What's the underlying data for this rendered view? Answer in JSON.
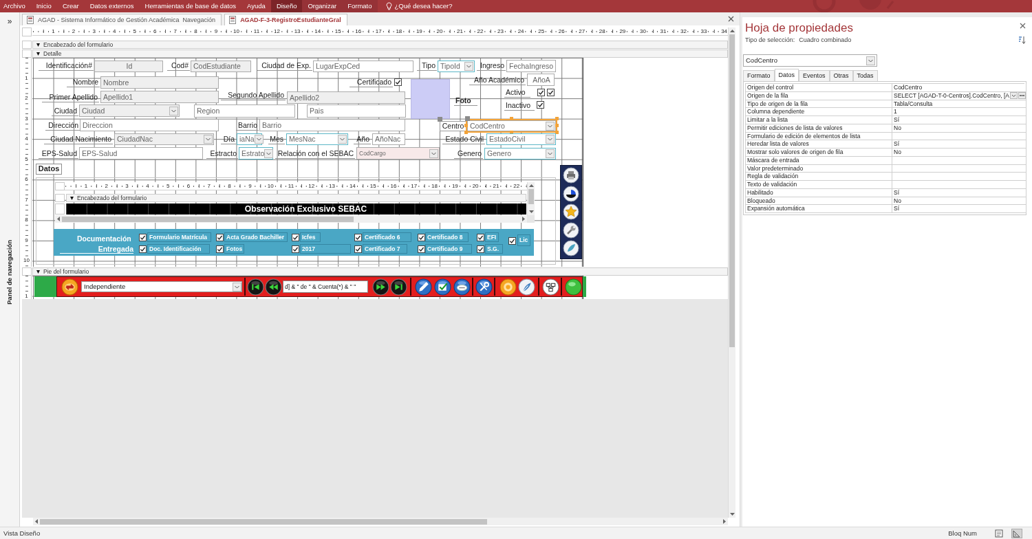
{
  "menu_bar": {
    "items": [
      {
        "label": "Archivo",
        "selected": false,
        "contextual": false
      },
      {
        "label": "Inicio",
        "selected": false,
        "contextual": false
      },
      {
        "label": "Crear",
        "selected": false,
        "contextual": false
      },
      {
        "label": "Datos externos",
        "selected": false,
        "contextual": false
      },
      {
        "label": "Herramientas de base de datos",
        "selected": false,
        "contextual": false
      },
      {
        "label": "Ayuda",
        "selected": false,
        "contextual": false
      },
      {
        "label": "Diseño",
        "selected": true,
        "contextual": true
      },
      {
        "label": "Organizar",
        "selected": false,
        "contextual": true
      },
      {
        "label": "Formato",
        "selected": false,
        "contextual": true
      }
    ],
    "tell_me": "¿Qué desea hacer?"
  },
  "navigation_pane": {
    "toggle": "»",
    "title": "Panel de navegación"
  },
  "document_tabs": [
    {
      "label": "AGAD - Sistema Informático de Gestión Académica  Navegación",
      "selected": false
    },
    {
      "label": "AGAD-F-3-RegistroEstudianteGral",
      "selected": true
    }
  ],
  "ruler": [
    "1",
    "2",
    "3",
    "4",
    "5",
    "6",
    "7",
    "8",
    "9",
    "10",
    "11",
    "12",
    "13",
    "14",
    "15",
    "16",
    "17",
    "18",
    "19",
    "20",
    "21",
    "22",
    "23",
    "24",
    "25",
    "26",
    "27",
    "28",
    "29",
    "30",
    "31",
    "32",
    "33",
    "34"
  ],
  "sections": {
    "header": "Encabezado del formulario",
    "detail": "Detalle",
    "footer": "Pie del formulario"
  },
  "detail_ruler": [
    "1",
    "2",
    "3",
    "4",
    "5",
    "6",
    "7",
    "8",
    "9",
    "10"
  ],
  "footer_ruler": [
    "1"
  ],
  "detail_controls": [
    {
      "kind": "label",
      "text": "Identificación#",
      "selected": false
    },
    {
      "kind": "textbox",
      "value": "Id",
      "color": "#efefef",
      "selected": false
    },
    {
      "kind": "label",
      "text": "Cod#",
      "selected": false
    },
    {
      "kind": "textbox",
      "value": "CodEstudiante",
      "color": "#efefef",
      "selected": false
    },
    {
      "kind": "label",
      "text": "Ciudad de Exp.",
      "selected": false
    },
    {
      "kind": "textbox",
      "value": "LugarExpCed",
      "color": "#ffffff",
      "selected": false
    },
    {
      "kind": "label",
      "text": "Tipo",
      "selected": false
    },
    {
      "kind": "combo",
      "value": "TipoId",
      "color": "#ffffff",
      "border": {
        "color": "#5bb6c6"
      },
      "selected": false
    },
    {
      "kind": "label",
      "text": "Ingreso",
      "selected": false
    },
    {
      "kind": "textbox",
      "value": "FechaIngreso",
      "color": "#ffffff",
      "selected": false
    },
    {
      "kind": "label",
      "text": "Nombre",
      "selected": false
    },
    {
      "kind": "textbox",
      "value": "Nombre",
      "color": "#efefef",
      "selected": false
    },
    {
      "kind": "label",
      "text": "Certificado",
      "selected": false
    },
    {
      "kind": "checkbox",
      "checked": true,
      "selected": false
    },
    {
      "kind": "image",
      "color": "#ccccf6",
      "selected": false
    },
    {
      "kind": "label",
      "text": "Año Académico",
      "selected": false
    },
    {
      "kind": "textbox",
      "value": "AñoA",
      "color": "#ffffff",
      "selected": false
    },
    {
      "kind": "label",
      "text": "Primer Apellido",
      "selected": false
    },
    {
      "kind": "textbox",
      "value": "Apellido1",
      "color": "#efefef",
      "selected": false
    },
    {
      "kind": "label",
      "text": "Segundo Apellido",
      "selected": false
    },
    {
      "kind": "textbox",
      "value": "Apellido2",
      "color": "#efefef",
      "selected": false
    },
    {
      "kind": "caption",
      "text": "Foto",
      "selected": false
    },
    {
      "kind": "label",
      "text": "Activo",
      "selected": false
    },
    {
      "kind": "checkbox",
      "checked": true,
      "selected": false
    },
    {
      "kind": "checkbox",
      "checked": true,
      "selected": false
    },
    {
      "kind": "label",
      "text": "Ciudad",
      "selected": false
    },
    {
      "kind": "combo",
      "value": "Ciudad",
      "color": "#efefef",
      "selected": false
    },
    {
      "kind": "textbox",
      "value": "Region",
      "color": "#ffffff",
      "selected": false
    },
    {
      "kind": "textbox",
      "value": "Pais",
      "color": "#ffffff",
      "selected": false
    },
    {
      "kind": "label",
      "text": "Inactivo",
      "selected": false
    },
    {
      "kind": "checkbox",
      "checked": true,
      "selected": false
    },
    {
      "kind": "label",
      "text": "Dirección",
      "selected": false
    },
    {
      "kind": "textbox",
      "value": "Direccion",
      "color": "#ffffff",
      "selected": false
    },
    {
      "kind": "label",
      "text": "Barrio",
      "selected": false
    },
    {
      "kind": "textbox",
      "value": "Barrio",
      "color": "#ffffff",
      "selected": false
    },
    {
      "kind": "label",
      "text": "Centro",
      "selected": true
    },
    {
      "kind": "combo",
      "value": "CodCentro",
      "color": "#ffffff",
      "selected": true
    },
    {
      "kind": "label",
      "text": "Ciudad Nacimiento",
      "selected": false
    },
    {
      "kind": "combo",
      "value": "CiudadNac",
      "color": "#efefef",
      "selected": false
    },
    {
      "kind": "label",
      "text": "Día",
      "selected": false
    },
    {
      "kind": "combo",
      "value": "iaNa",
      "color": "#ffffff",
      "border": {
        "color": "#5bb6c6"
      },
      "selected": false
    },
    {
      "kind": "label",
      "text": "Mes",
      "selected": false
    },
    {
      "kind": "combo",
      "value": "MesNac",
      "color": "#ffffff",
      "border": {
        "color": "#5bb6c6"
      },
      "selected": false
    },
    {
      "kind": "label",
      "text": "Año",
      "selected": false
    },
    {
      "kind": "textbox",
      "value": "AñoNac",
      "color": "#ffffff",
      "selected": false
    },
    {
      "kind": "label",
      "text": "Estado Civil",
      "selected": false
    },
    {
      "kind": "combo",
      "value": "EstadoCivil",
      "color": "#ffffff",
      "border": {
        "color": "#5bb6c6"
      },
      "selected": false
    },
    {
      "kind": "label",
      "text": "EPS-Salud",
      "selected": false
    },
    {
      "kind": "textbox",
      "value": "EPS-Salud",
      "color": "#ffffff",
      "selected": false
    },
    {
      "kind": "label",
      "text": "Estracto",
      "selected": false
    },
    {
      "kind": "combo",
      "value": "Estrato",
      "color": "#ffffff",
      "border": {
        "color": "#5bb6c6"
      },
      "selected": false
    },
    {
      "kind": "label",
      "text": "Relación con el SEBAC",
      "selected": false
    },
    {
      "kind": "combo",
      "value": "CodCargo",
      "color": "#f8e9e9",
      "selected": false
    },
    {
      "kind": "label",
      "text": "Genero",
      "selected": false
    },
    {
      "kind": "combo",
      "value": "Genero",
      "color": "#ffffff",
      "border": {
        "color": "#5bb6c6"
      },
      "selected": false
    }
  ],
  "subform": {
    "label": "Datos",
    "ruler": [
      "1",
      "2",
      "3",
      "4",
      "5",
      "6",
      "7",
      "8",
      "9",
      "10",
      "11",
      "12",
      "13",
      "14",
      "15",
      "16",
      "17",
      "18",
      "19",
      "20",
      "21",
      "22"
    ],
    "header": "Encabezado del formulario",
    "banner": "Observación Exclusivo SEBAC"
  },
  "documents": {
    "title": "Documentación",
    "subtitle": "Entregada",
    "items": [
      {
        "label": "Formulario Matrícula",
        "checked": true
      },
      {
        "label": "Acta Grado Bachiller",
        "checked": true
      },
      {
        "label": "Icfes",
        "checked": true
      },
      {
        "label": "Certificado 6",
        "checked": true
      },
      {
        "label": "Certificado 8",
        "checked": true
      },
      {
        "label": "EFI",
        "checked": true
      },
      {
        "label": "Lic",
        "checked": true
      },
      {
        "label": "Doc. Identificación",
        "checked": true
      },
      {
        "label": "Fotos",
        "checked": true
      },
      {
        "label": "2017",
        "checked": true
      },
      {
        "label": "Certificado 7",
        "checked": true
      },
      {
        "label": "Certificado 9",
        "checked": true
      },
      {
        "label": "S.G.",
        "checked": true
      }
    ]
  },
  "footer": {
    "filter": "Independiente",
    "expression": "d] & \" de \" & Cuenta(*) & \" \""
  },
  "property_sheet": {
    "title": "Hoja de propiedades",
    "selection_label": "Tipo de selección:",
    "selection_type": "Cuadro combinado",
    "object": "CodCentro",
    "tabs": [
      {
        "label": "Formato",
        "selected": false
      },
      {
        "label": "Datos",
        "selected": true
      },
      {
        "label": "Eventos",
        "selected": false
      },
      {
        "label": "Otras",
        "selected": false
      },
      {
        "label": "Todas",
        "selected": false
      }
    ],
    "properties": [
      {
        "name": "Origen del control",
        "value": "CodCentro",
        "selected": false
      },
      {
        "name": "Origen de la fila",
        "value": "SELECT [AGAD-T-0-Centros].CodCentro, [A",
        "selected": true
      },
      {
        "name": "Tipo de origen de la fila",
        "value": "Tabla/Consulta",
        "selected": false
      },
      {
        "name": "Columna dependiente",
        "value": "1",
        "selected": false
      },
      {
        "name": "Limitar a la lista",
        "value": "Sí",
        "selected": false
      },
      {
        "name": "Permitir ediciones de lista de valores",
        "value": "No",
        "selected": false
      },
      {
        "name": "Formulario de edición de elementos de lista",
        "selected": false
      },
      {
        "name": "Heredar lista de valores",
        "value": "Sí",
        "selected": false
      },
      {
        "name": "Mostrar solo valores de origen de fila",
        "value": "No",
        "selected": false
      },
      {
        "name": "Máscara de entrada",
        "selected": false
      },
      {
        "name": "Valor predeterminado",
        "selected": false
      },
      {
        "name": "Regla de validación",
        "selected": false
      },
      {
        "name": "Texto de validación",
        "selected": false
      },
      {
        "name": "Habilitado",
        "value": "Sí",
        "selected": false
      },
      {
        "name": "Bloqueado",
        "value": "No",
        "selected": false
      },
      {
        "name": "Expansión automática",
        "value": "Sí",
        "selected": false
      }
    ]
  },
  "status_bar": {
    "mode": "Vista Diseño",
    "indicator": "Bloq Num",
    "views": [
      {
        "selected": false
      },
      {
        "selected": true
      }
    ]
  }
}
